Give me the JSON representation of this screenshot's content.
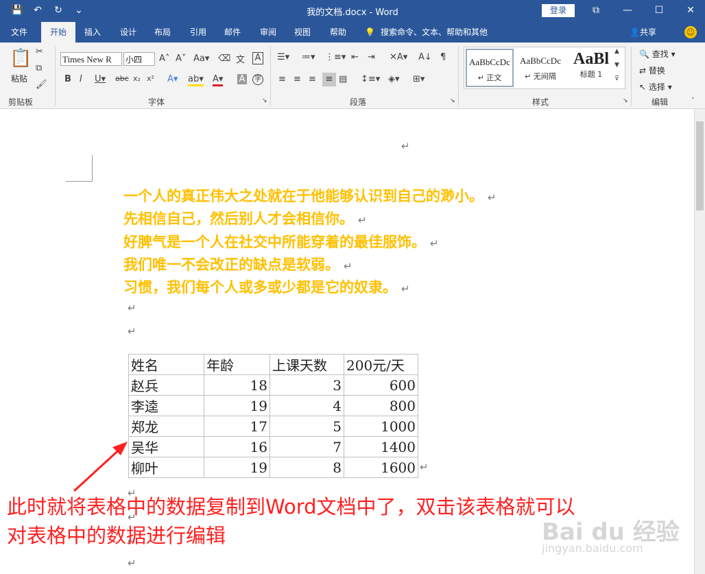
{
  "titlebar": {
    "doc_title": "我的文档.docx  -  Word",
    "login": "登录",
    "save_icon": "💾",
    "undo_icon": "↶",
    "redo_icon": "↻",
    "customize_icon": "⌄",
    "ribbon_opts_icon": "⧉",
    "minimize_icon": "—",
    "maximize_icon": "☐",
    "close_icon": "✕"
  },
  "tabs": [
    {
      "label": "文件"
    },
    {
      "label": "开始"
    },
    {
      "label": "插入"
    },
    {
      "label": "设计"
    },
    {
      "label": "布局"
    },
    {
      "label": "引用"
    },
    {
      "label": "邮件"
    },
    {
      "label": "审阅"
    },
    {
      "label": "视图"
    },
    {
      "label": "帮助"
    }
  ],
  "search_commands": "搜索命令、文本、帮助和其他",
  "share": "共享",
  "ribbon": {
    "clipboard": {
      "paste": "粘贴",
      "label": "剪贴板"
    },
    "font": {
      "name": "Times New R",
      "size": "小四",
      "label": "字体"
    },
    "paragraph": {
      "label": "段落"
    },
    "styles": {
      "label": "样式",
      "items": [
        {
          "sample": "AaBbCcDc",
          "name": "↵ 正文"
        },
        {
          "sample": "AaBbCcDc",
          "name": "↵ 无间隔"
        },
        {
          "sample": "AaBl",
          "name": "标题 1"
        }
      ]
    },
    "editing": {
      "find": "查找",
      "replace": "替换",
      "select": "选择",
      "label": "编辑"
    }
  },
  "document": {
    "pilcrow": "↵",
    "quotes": [
      "一个人的真正伟大之处就在于他能够认识到自己的渺小。",
      "先相信自己，然后别人才会相信你。",
      "好脾气是一个人在社交中所能穿着的最佳服饰。",
      "我们唯一不会改正的缺点是软弱。",
      "习惯，我们每个人或多或少都是它的奴隶。"
    ],
    "table": {
      "headers": [
        "姓名",
        "年龄",
        "上课天数",
        "200元/天"
      ],
      "rows": [
        [
          "赵兵",
          "18",
          "3",
          "600"
        ],
        [
          "李逵",
          "19",
          "4",
          "800"
        ],
        [
          "郑龙",
          "17",
          "5",
          "1000"
        ],
        [
          "吴华",
          "16",
          "7",
          "1400"
        ],
        [
          "柳叶",
          "19",
          "8",
          "1600"
        ]
      ]
    }
  },
  "annotation": {
    "line1": "此时就将表格中的数据复制到Word文档中了，双击该表格就可以",
    "line2": "对表格中的数据进行编辑",
    "color": "#ff2020"
  },
  "watermark": {
    "main": "Bai du 经验",
    "sub": "jingyan.baidu.com"
  }
}
